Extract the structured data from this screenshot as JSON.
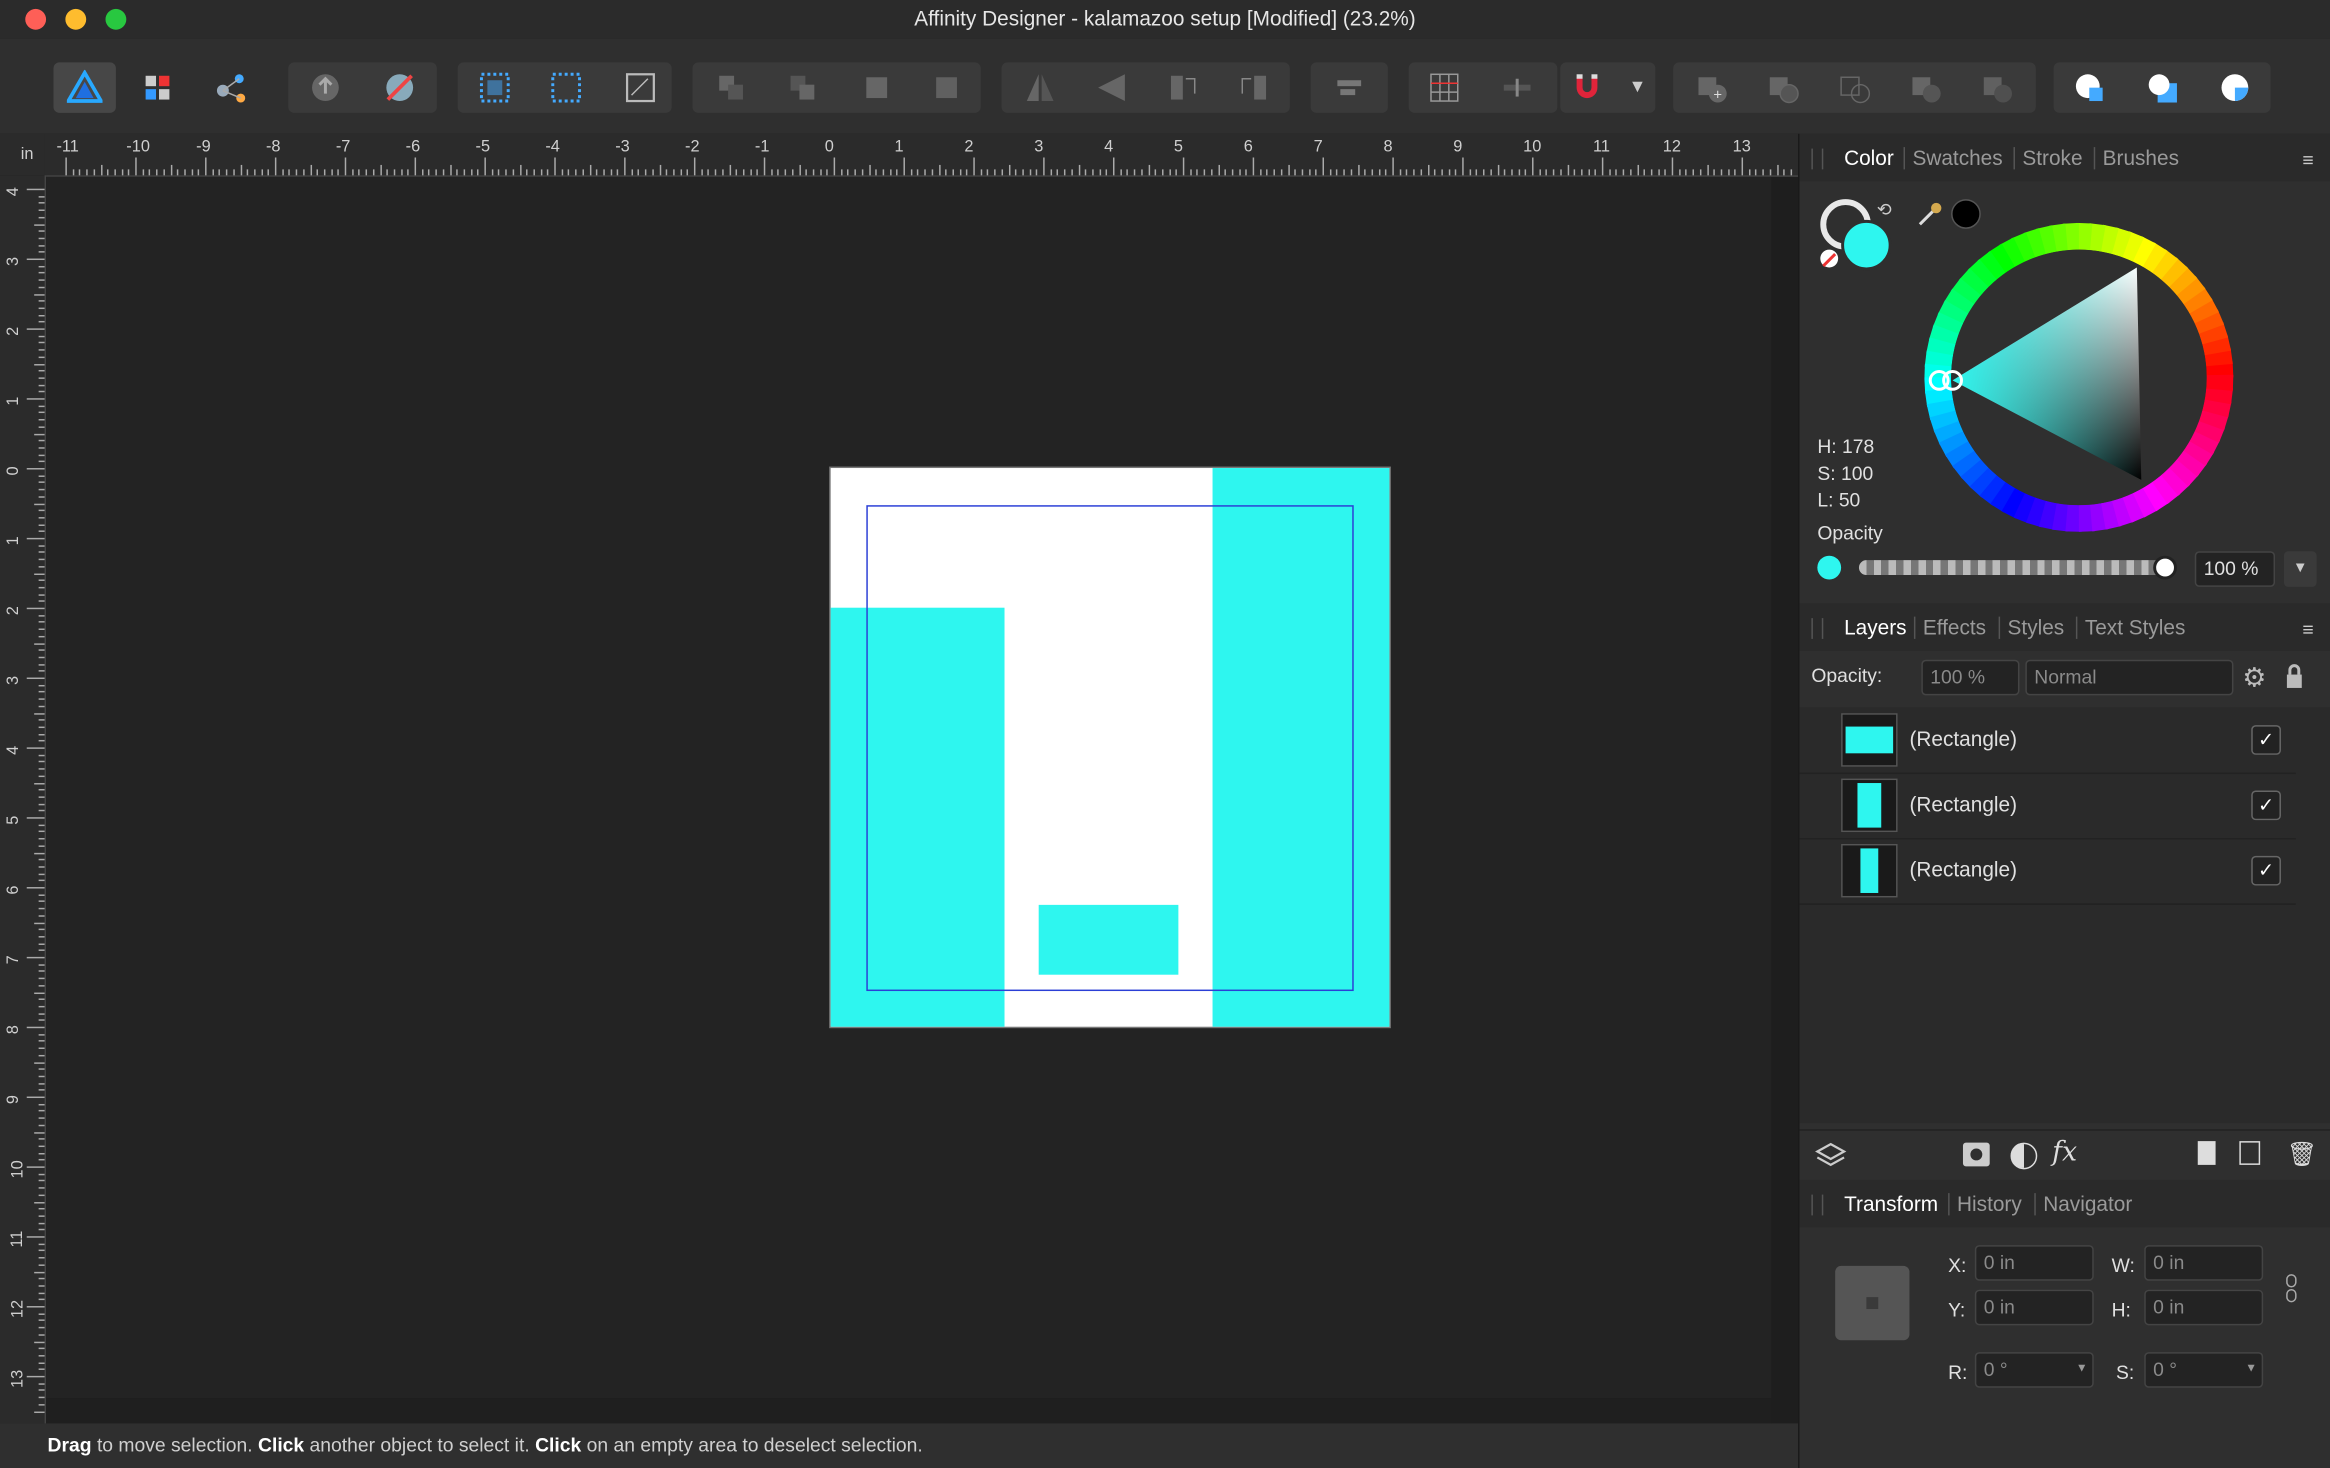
{
  "window": {
    "title": "Affinity Designer - kalamazoo setup [Modified] (23.2%)"
  },
  "ruler": {
    "unit": "in",
    "top_labels": [
      "-11",
      "-10",
      "-9",
      "-8",
      "-7",
      "-6",
      "-5",
      "-4",
      "-3",
      "-2",
      "-1",
      "0",
      "1",
      "2",
      "3",
      "4",
      "5",
      "6",
      "7",
      "8",
      "9",
      "10",
      "11",
      "12",
      "13"
    ],
    "left_labels": [
      "4",
      "3",
      "2",
      "1",
      "0",
      "1",
      "2",
      "3",
      "4",
      "5",
      "6",
      "7",
      "8",
      "9",
      "10",
      "11",
      "12",
      "13"
    ]
  },
  "color_panel": {
    "tabs": [
      "Color",
      "Swatches",
      "Stroke",
      "Brushes"
    ],
    "active_tab": "Color",
    "h": "H: 178",
    "s": "S: 100",
    "l": "L: 50",
    "opacity_label": "Opacity",
    "opacity_value": "100 %",
    "fill_color": "#2ef6ef"
  },
  "layers_panel": {
    "tabs": [
      "Layers",
      "Effects",
      "Styles",
      "Text Styles"
    ],
    "active_tab": "Layers",
    "opacity_label": "Opacity:",
    "opacity_value": "100 %",
    "blend_mode": "Normal",
    "layers": [
      {
        "name": "(Rectangle)",
        "checked": "✓"
      },
      {
        "name": "(Rectangle)",
        "checked": "✓"
      },
      {
        "name": "(Rectangle)",
        "checked": "✓"
      }
    ]
  },
  "transform_panel": {
    "tabs": [
      "Transform",
      "History",
      "Navigator"
    ],
    "active_tab": "Transform",
    "x_label": "X:",
    "x_value": "0 in",
    "y_label": "Y:",
    "y_value": "0 in",
    "w_label": "W:",
    "w_value": "0 in",
    "h_label": "H:",
    "h_value": "0 in",
    "r_label": "R:",
    "r_value": "0 °",
    "s_label": "S:",
    "s_value": "0 °"
  },
  "status": {
    "drag": "Drag",
    "t1": " to move selection. ",
    "click1": "Click",
    "t2": " another object to select it. ",
    "click2": "Click",
    "t3": " on an empty area to deselect selection."
  },
  "colors": {
    "accent": "#2ef6ef",
    "selection": "#2b3fd6",
    "artboard": "#ffffff"
  }
}
